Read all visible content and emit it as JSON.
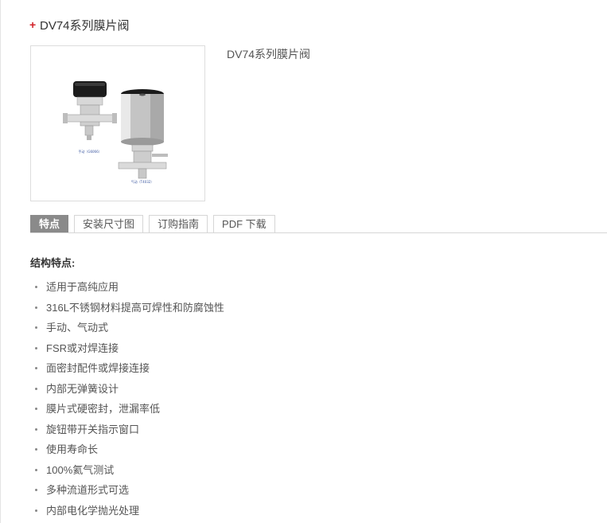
{
  "header": {
    "title": "DV74系列膜片阀",
    "bullet_color": "#d2232a"
  },
  "product": {
    "name": "DV74系列膜片阀",
    "image_caption_left": "手动（G6066）",
    "image_caption_right": "气动（T4032）"
  },
  "tabs": [
    {
      "label": "特点",
      "active": true
    },
    {
      "label": "安装尺寸图",
      "active": false
    },
    {
      "label": "订购指南",
      "active": false
    },
    {
      "label": "PDF 下载",
      "active": false
    }
  ],
  "features": {
    "title": "结构特点:",
    "items": [
      "适用于高纯应用",
      "316L不锈钢材料提高可焊性和防腐蚀性",
      "手动、气动式",
      "FSR或对焊连接",
      "面密封配件或焊接连接",
      "内部无弹簧设计",
      "膜片式硬密封，泄漏率低",
      "旋钮带开关指示窗口",
      "使用寿命长",
      "100%氦气测试",
      "多种流道形式可选",
      "内部电化学抛光处理"
    ]
  }
}
